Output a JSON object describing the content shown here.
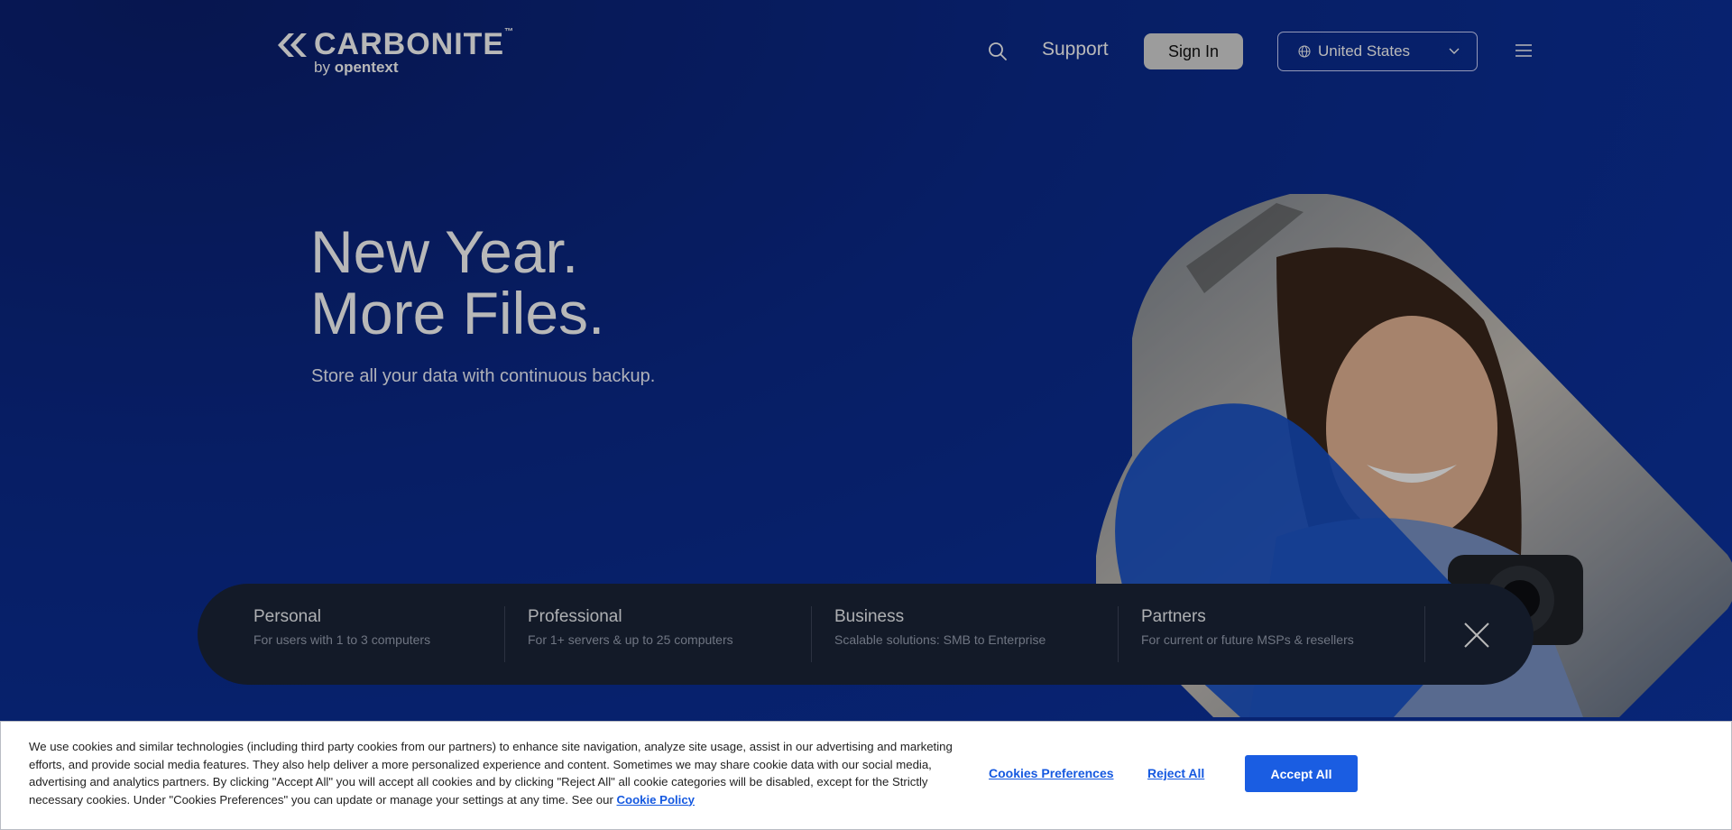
{
  "header": {
    "brand": "CARBONITE",
    "brand_mark": "™",
    "brand_by": "by",
    "brand_parent": "opentext",
    "support_label": "Support",
    "signin_label": "Sign In",
    "region_label": "United States"
  },
  "hero": {
    "title_line1": "New Year.",
    "title_line2": "More Files.",
    "subtitle": "Store all your data with continuous backup."
  },
  "categories": [
    {
      "title": "Personal",
      "desc": "For users with 1 to 3 computers"
    },
    {
      "title": "Professional",
      "desc": "For 1+ servers & up to 25 computers"
    },
    {
      "title": "Business",
      "desc": "Scalable solutions: SMB to Enterprise"
    },
    {
      "title": "Partners",
      "desc": "For current or future MSPs & resellers"
    }
  ],
  "cookie": {
    "text": "We use cookies and similar technologies (including third party cookies from our partners) to enhance site navigation, analyze site usage, assist in our advertising and marketing efforts, and provide social media features. They also help deliver a more personalized experience and content. Sometimes we may share cookie data with our social media, advertising and analytics partners. By clicking \"Accept All\" you will accept all cookies and by clicking \"Reject All\" all cookie categories will be disabled, except for the Strictly necessary cookies. Under \"Cookies Preferences\" you can update or manage your settings at any time. See our",
    "policy_label": "Cookie Policy",
    "prefs_label": "Cookies Preferences",
    "reject_label": "Reject All",
    "accept_label": "Accept All"
  },
  "colors": {
    "accent": "#1a5de2",
    "bar_bg": "#1b2438"
  },
  "icons": [
    "search-icon",
    "globe-icon",
    "chevron-down-icon",
    "menu-icon",
    "close-icon"
  ]
}
